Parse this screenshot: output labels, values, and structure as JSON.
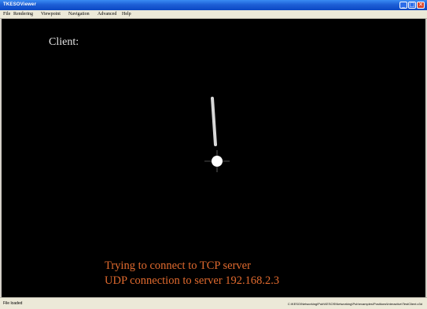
{
  "window": {
    "title": "TKESOViewer",
    "controls": {
      "minimize": "_",
      "maximize": "□",
      "close": "✕"
    }
  },
  "menu": {
    "items": [
      "File",
      "Rendering",
      "Viewpoint",
      "Navigation",
      "Advanced",
      "Help"
    ]
  },
  "scene": {
    "client_label": "Client:",
    "status_lines": [
      "Trying to connect to TCP server",
      "UDP connection to server 192.168.2.3"
    ]
  },
  "statusbar": {
    "left": "File loaded",
    "right": "C:\\KESO\\Networking\\Pub\\KESOS\\Networking\\Pub\\examples\\Positions\\Interactive\\TestClient.x3d"
  },
  "colors": {
    "viewport_bg": "#000000",
    "status_text": "#e06a2e",
    "client_text": "#e8e8e8"
  }
}
